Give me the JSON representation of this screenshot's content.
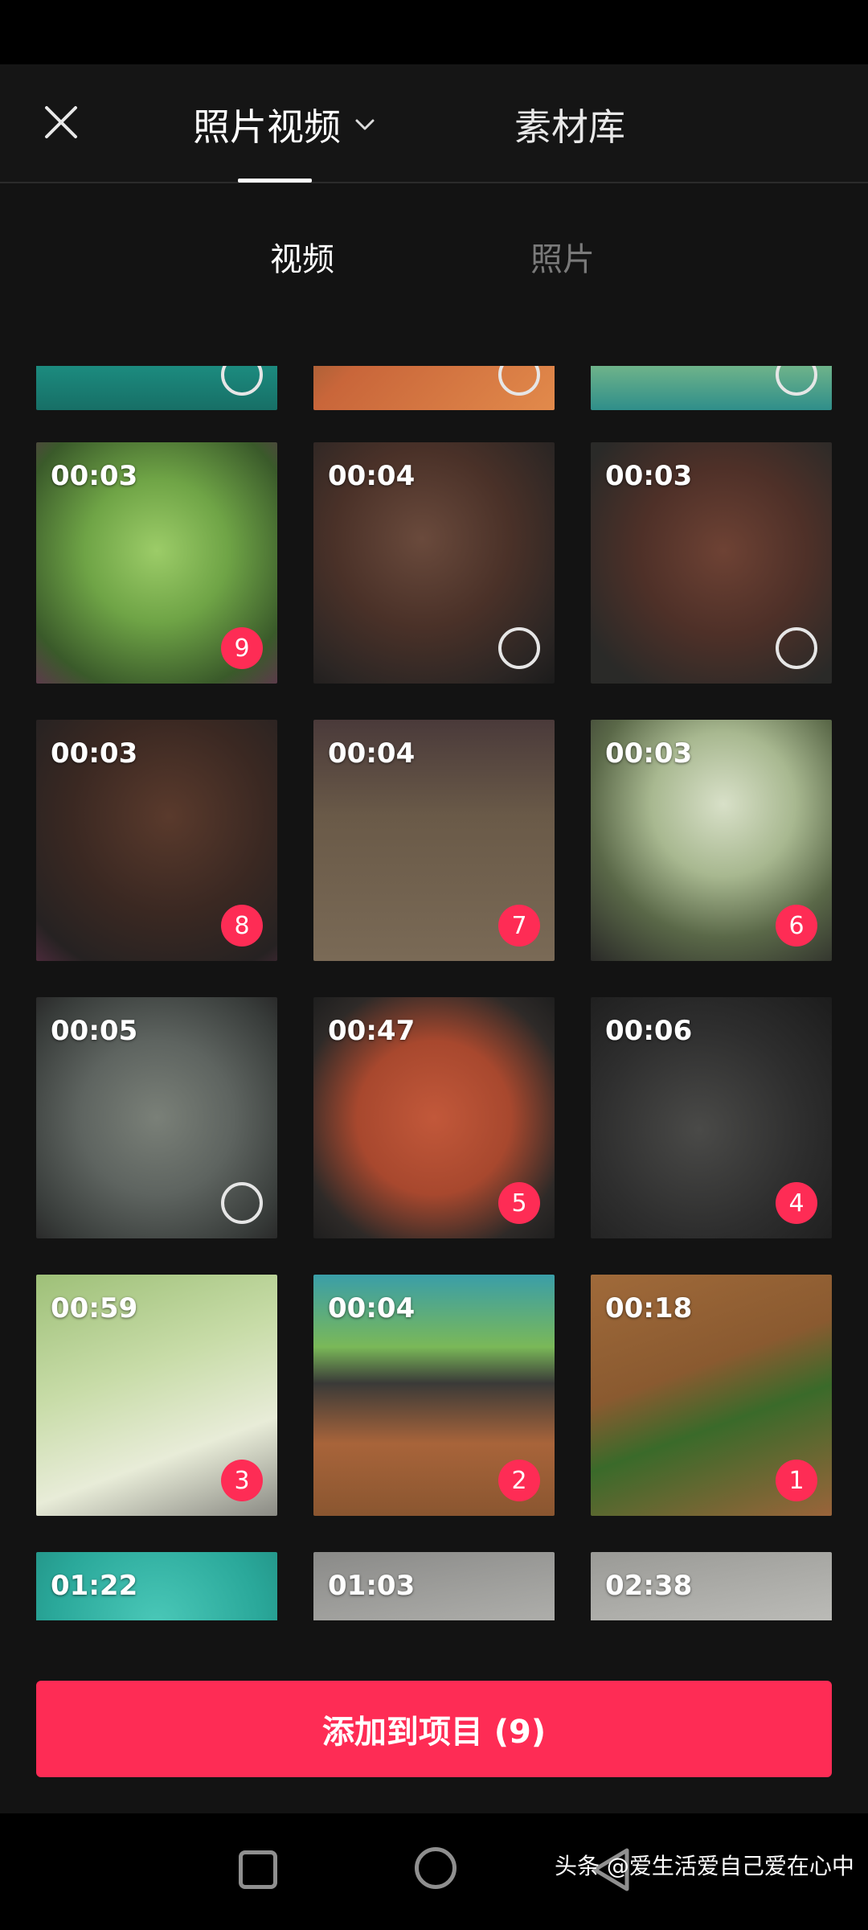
{
  "header": {
    "tab_photos_videos": "照片视频",
    "tab_library": "素材库"
  },
  "subtabs": {
    "video": "视频",
    "photo": "照片"
  },
  "grid": {
    "tiles": [
      {
        "duration": "00:03",
        "selection": "9"
      },
      {
        "duration": "00:04",
        "selection": ""
      },
      {
        "duration": "00:03",
        "selection": ""
      },
      {
        "duration": "00:03",
        "selection": "8"
      },
      {
        "duration": "00:04",
        "selection": "7"
      },
      {
        "duration": "00:03",
        "selection": "6"
      },
      {
        "duration": "00:05",
        "selection": ""
      },
      {
        "duration": "00:47",
        "selection": "5"
      },
      {
        "duration": "00:06",
        "selection": "4"
      },
      {
        "duration": "00:59",
        "selection": "3"
      },
      {
        "duration": "00:04",
        "selection": "2"
      },
      {
        "duration": "00:18",
        "selection": "1"
      },
      {
        "duration": "01:22",
        "selection": ""
      },
      {
        "duration": "01:03",
        "selection": ""
      },
      {
        "duration": "02:38",
        "selection": ""
      }
    ]
  },
  "footer": {
    "add_button": "添加到项目 (9)"
  },
  "watermark": "头条 @爱生活爱自己爱在心中",
  "colors": {
    "accent": "#fe2c55",
    "background": "#131313"
  }
}
